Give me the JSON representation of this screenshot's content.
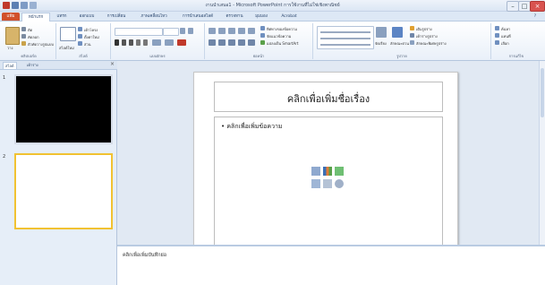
{
  "app": {
    "title": "งานนำเสนอ1 - Microsoft PowerPoint การใช้งานที่ไม่ใช่เชิงพาณิชย์"
  },
  "tabs": [
    {
      "label": "แฟ้ม"
    },
    {
      "label": "หน้าแรก"
    },
    {
      "label": "แทรก"
    },
    {
      "label": "ออกแบบ"
    },
    {
      "label": "การเปลี่ยน"
    },
    {
      "label": "ภาพเคลื่อนไหว"
    },
    {
      "label": "การนำเสนอสไลด์"
    },
    {
      "label": "ตรวจทาน"
    },
    {
      "label": "มุมมอง"
    },
    {
      "label": "Acrobat"
    }
  ],
  "ribbon": {
    "clipboard": {
      "label": "คลิปบอร์ด",
      "paste": "วาง",
      "cut": "ตัด",
      "copy": "คัดลอก",
      "format_painter": "ตัวคัดวางรูปแบบ"
    },
    "slides": {
      "label": "สไลด์",
      "new_slide": "สไลด์ใหม่",
      "layout": "เค้าโครง",
      "reset": "ตั้งค่าใหม่",
      "section": "ส่วน"
    },
    "font": {
      "label": "แบบอักษร"
    },
    "paragraph": {
      "label": "ย่อหน้า",
      "text_direction": "ทิศทางของข้อความ",
      "align_text": "จัดแนวข้อความ",
      "smartart": "แปลงเป็น SmartArt"
    },
    "drawing": {
      "label": "รูปวาด",
      "arrange": "จัดเรียง",
      "quick_styles": "ลักษณะด่วน",
      "shape_fill": "เติมรูปร่าง",
      "shape_outline": "เค้าร่างรูปร่าง",
      "shape_effects": "ลักษณะพิเศษรูปร่าง"
    },
    "editing": {
      "label": "การแก้ไข",
      "find": "ค้นหา",
      "replace": "แทนที่",
      "select": "เลือก"
    }
  },
  "leftpane": {
    "tab_slides": "สไลด์",
    "tab_outline": "เค้าร่าง",
    "slides": [
      {
        "number": "1"
      },
      {
        "number": "2"
      }
    ]
  },
  "slide": {
    "title_placeholder": "คลิกเพื่อเพิ่มชื่อเรื่อง",
    "content_placeholder": "• คลิกเพื่อเพิ่มข้อความ"
  },
  "notes": {
    "placeholder": "คลิกเพื่อเพิ่มบันทึกย่อ"
  },
  "colors": {
    "file_tab": "#d1502b",
    "accent": "#2c4566",
    "selected_thumb": "#f1c232"
  },
  "icons": [
    "save-icon",
    "undo-icon",
    "redo-icon",
    "paste-icon",
    "new-slide-icon",
    "table-icon",
    "chart-icon",
    "smartart-icon",
    "picture-icon",
    "clipart-icon",
    "media-icon"
  ]
}
